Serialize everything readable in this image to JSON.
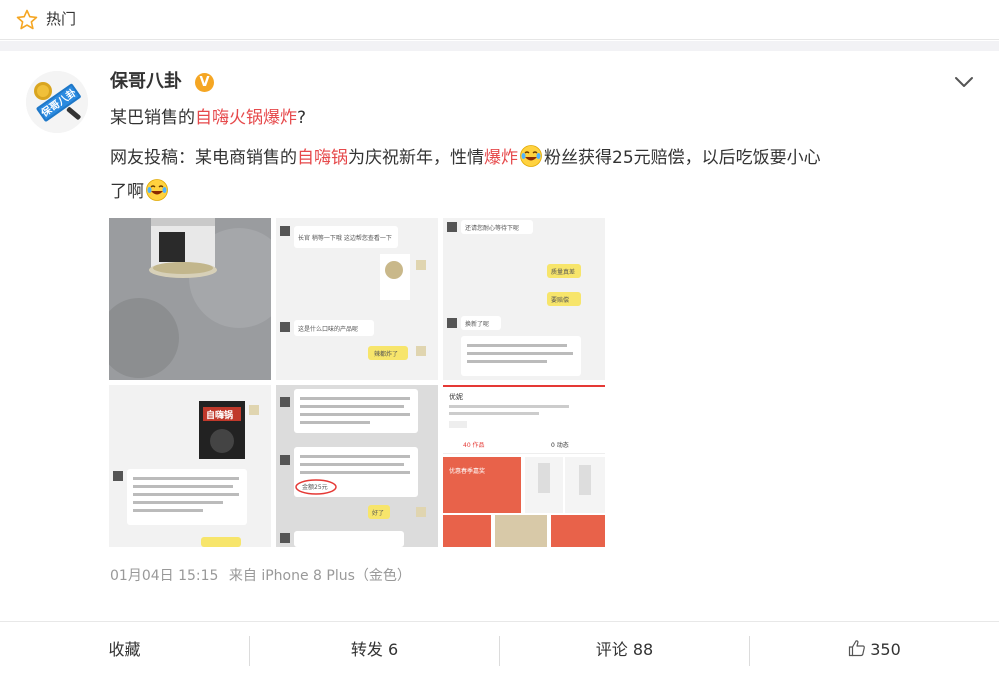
{
  "topbar": {
    "title": "热门",
    "icon": "star-icon"
  },
  "post": {
    "author": "保哥八卦",
    "verified_badge": "V",
    "title_parts": [
      "某巴销售的",
      "自嗨火",
      "锅",
      "爆炸",
      "?"
    ],
    "body_parts": [
      "网友投稿：某电商销售的",
      "自嗨锅",
      "为庆祝新年，性情",
      "爆炸",
      "粉丝获得25元赔偿，以后吃饭要小心"
    ],
    "body_tail": "了啊",
    "timestamp": "01月04日 15:15",
    "source": "来自 iPhone 8 Plus（金色）"
  },
  "images": {
    "chat_texts": [
      "长官 稍等一下哦 这边帮您查看一下",
      "这是什么口味的产品呢",
      "辣都炸了",
      "还请您耐心等待下呢",
      "质量真差",
      "要赔偿",
      "换新了呢",
      "自嗨锅",
      "好了",
      "优妮",
      "40 作品",
      "0 动态",
      "优惠春季嘉奖",
      "金额25元"
    ]
  },
  "actions": {
    "favorite": "收藏",
    "repost": "转发 6",
    "comment": "评论 88",
    "like": "350"
  },
  "colors": {
    "accent_red": "#e6494b",
    "badge": "#f5a623",
    "meta": "#999999"
  }
}
